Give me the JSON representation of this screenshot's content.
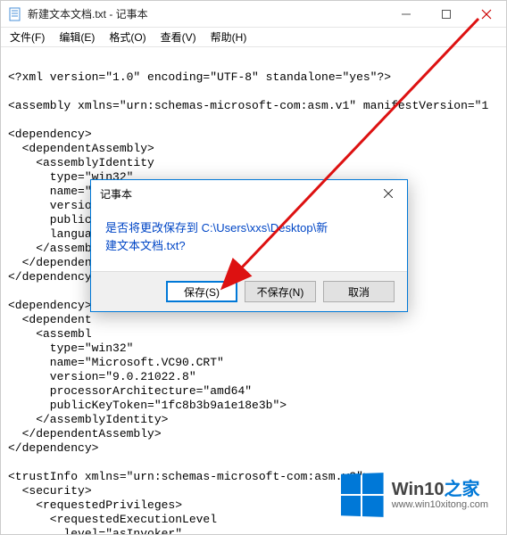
{
  "window": {
    "title": "新建文本文档.txt - 记事本"
  },
  "menu": {
    "file": "文件(F)",
    "edit": "编辑(E)",
    "format": "格式(O)",
    "view": "查看(V)",
    "help": "帮助(H)"
  },
  "content": "\n<?xml version=\"1.0\" encoding=\"UTF-8\" standalone=\"yes\"?>\n\n<assembly xmlns=\"urn:schemas-microsoft-com:asm.v1\" manifestVersion=\"1\n\n<dependency>\n  <dependentAssembly>\n    <assemblyIdentity\n      type=\"win32\"\n      name=\"Microsoft.Windows.Common-Controls\"\n      version=\"6.0.0.0\" processorArchitecture=\"*\"\n      public\n      langua\n    </assembl\n  </dependent\n</dependency\n\n<dependency>\n  <dependent\n    <assembl\n      type=\"win32\"\n      name=\"Microsoft.VC90.CRT\"\n      version=\"9.0.21022.8\"\n      processorArchitecture=\"amd64\"\n      publicKeyToken=\"1fc8b3b9a1e18e3b\">\n    </assemblyIdentity>\n  </dependentAssembly>\n</dependency>\n\n<trustInfo xmlns=\"urn:schemas-microsoft-com:asm.v3\">\n  <security>\n    <requestedPrivileges>\n      <requestedExecutionLevel\n        level=\"asInvoker\"",
  "dialog": {
    "title": "记事本",
    "message_line1": "是否将更改保存到 C:\\Users\\xxs\\Desktop\\新",
    "message_line2": "建文本文档.txt?",
    "save": "保存(S)",
    "dont_save": "不保存(N)",
    "cancel": "取消"
  },
  "watermark": {
    "brand_pre": "Win10",
    "brand_suffix": "之家",
    "url": "www.win10xitong.com"
  }
}
